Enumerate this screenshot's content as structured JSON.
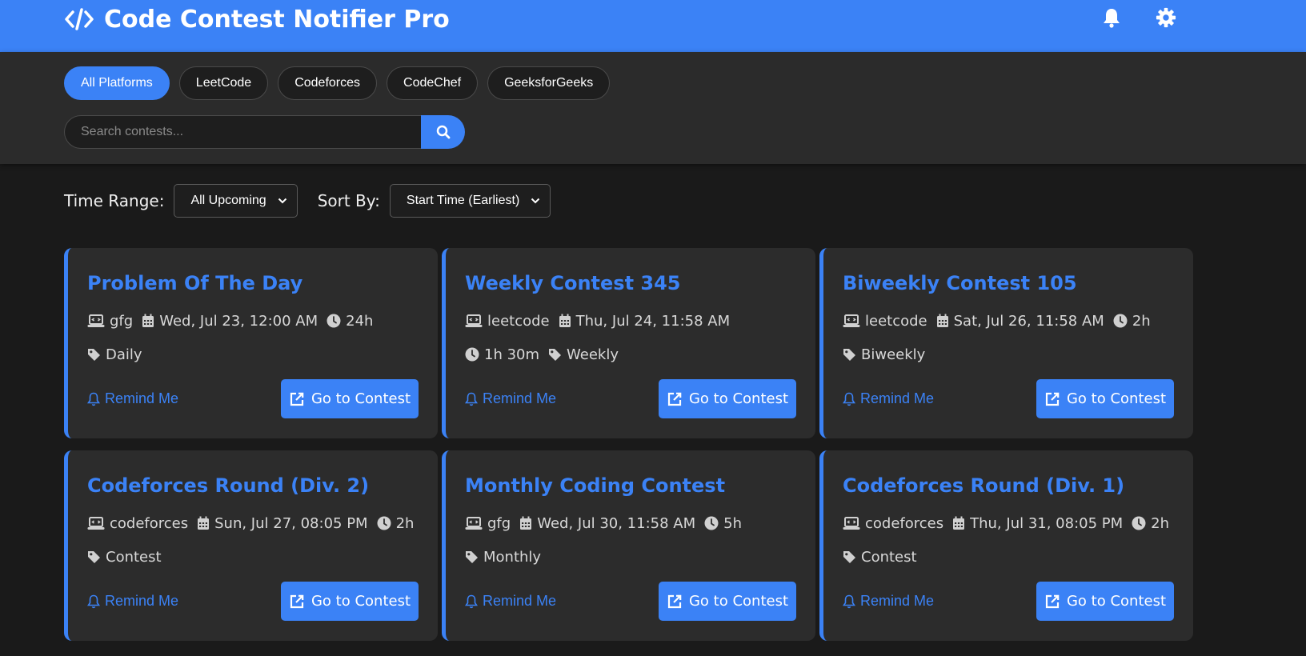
{
  "header": {
    "title": "Code Contest Notifier Pro",
    "icons": [
      "code-icon",
      "bell-icon",
      "settings-icon"
    ]
  },
  "filters": {
    "platforms": [
      "All Platforms",
      "LeetCode",
      "Codeforces",
      "CodeChef",
      "GeeksforGeeks"
    ],
    "active_platform": "All Platforms",
    "search_placeholder": "Search contests...",
    "search_value": ""
  },
  "controls": {
    "time_range_label": "Time Range:",
    "time_range_value": "All Upcoming",
    "sort_label": "Sort By:",
    "sort_value": "Start Time (Earliest)"
  },
  "colors": {
    "accent": "#3b82f6",
    "background": "#1a1a1a",
    "card": "#2c2c2c"
  },
  "cards": [
    {
      "title": "Problem Of The Day",
      "platform": "gfg",
      "date": "Wed, Jul 23, 12:00 AM",
      "duration": "24h",
      "tag": "Daily",
      "remind": "Remind Me",
      "goto": "Go to Contest"
    },
    {
      "title": "Weekly Contest 345",
      "platform": "leetcode",
      "date": "Thu, Jul 24, 11:58 AM",
      "duration": "1h 30m",
      "tag": "Weekly",
      "remind": "Remind Me",
      "goto": "Go to Contest"
    },
    {
      "title": "Biweekly Contest 105",
      "platform": "leetcode",
      "date": "Sat, Jul 26, 11:58 AM",
      "duration": "2h",
      "tag": "Biweekly",
      "remind": "Remind Me",
      "goto": "Go to Contest"
    },
    {
      "title": "Codeforces Round (Div. 2)",
      "platform": "codeforces",
      "date": "Sun, Jul 27, 08:05 PM",
      "duration": "2h",
      "tag": "Contest",
      "remind": "Remind Me",
      "goto": "Go to Contest"
    },
    {
      "title": "Monthly Coding Contest",
      "platform": "gfg",
      "date": "Wed, Jul 30, 11:58 AM",
      "duration": "5h",
      "tag": "Monthly",
      "remind": "Remind Me",
      "goto": "Go to Contest"
    },
    {
      "title": "Codeforces Round (Div. 1)",
      "platform": "codeforces",
      "date": "Thu, Jul 31, 08:05 PM",
      "duration": "2h",
      "tag": "Contest",
      "remind": "Remind Me",
      "goto": "Go to Contest"
    }
  ]
}
